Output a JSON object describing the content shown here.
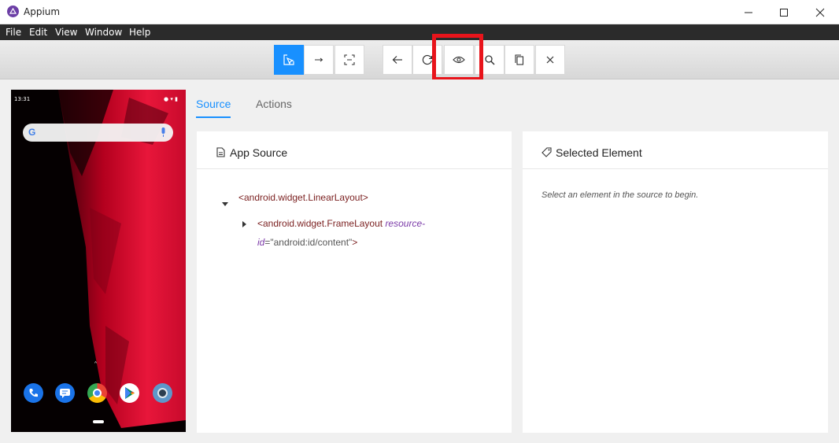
{
  "window": {
    "title": "Appium"
  },
  "menu": [
    "File",
    "Edit",
    "View",
    "Window",
    "Help"
  ],
  "toolbar": {
    "buttons": [
      {
        "name": "select-element-button",
        "icon": "select-cursor-icon",
        "active": true
      },
      {
        "name": "swipe-button",
        "icon": "swipe-arrow-icon",
        "active": false
      },
      {
        "name": "tap-coordinates-button",
        "icon": "crop-frame-icon",
        "active": false
      },
      {
        "name": "back-button",
        "icon": "arrow-left-icon",
        "active": false
      },
      {
        "name": "refresh-button",
        "icon": "refresh-icon",
        "active": false
      },
      {
        "name": "show-hide-button",
        "icon": "eye-icon",
        "active": false
      },
      {
        "name": "search-button",
        "icon": "search-icon",
        "active": false
      },
      {
        "name": "copy-xml-button",
        "icon": "copy-icon",
        "active": false
      },
      {
        "name": "quit-session-button",
        "icon": "close-icon",
        "active": false
      }
    ]
  },
  "phone": {
    "time": "13:31"
  },
  "tabs": {
    "source": "Source",
    "actions": "Actions",
    "active": "source"
  },
  "app_source": {
    "title": "App Source",
    "root": "<android.widget.LinearLayout>",
    "child_open": "<android.widget.FrameLayout ",
    "child_attr_name_1": "resource-",
    "child_attr_name_2": "id",
    "child_eq": "=",
    "child_attr_value": "\"android:id/content\"",
    "child_close": ">"
  },
  "selected_element": {
    "title": "Selected Element",
    "placeholder": "Select an element in the source to begin."
  },
  "colors": {
    "accent": "#1890ff",
    "highlight": "#e8141b",
    "menubar": "#2b2b2b"
  }
}
